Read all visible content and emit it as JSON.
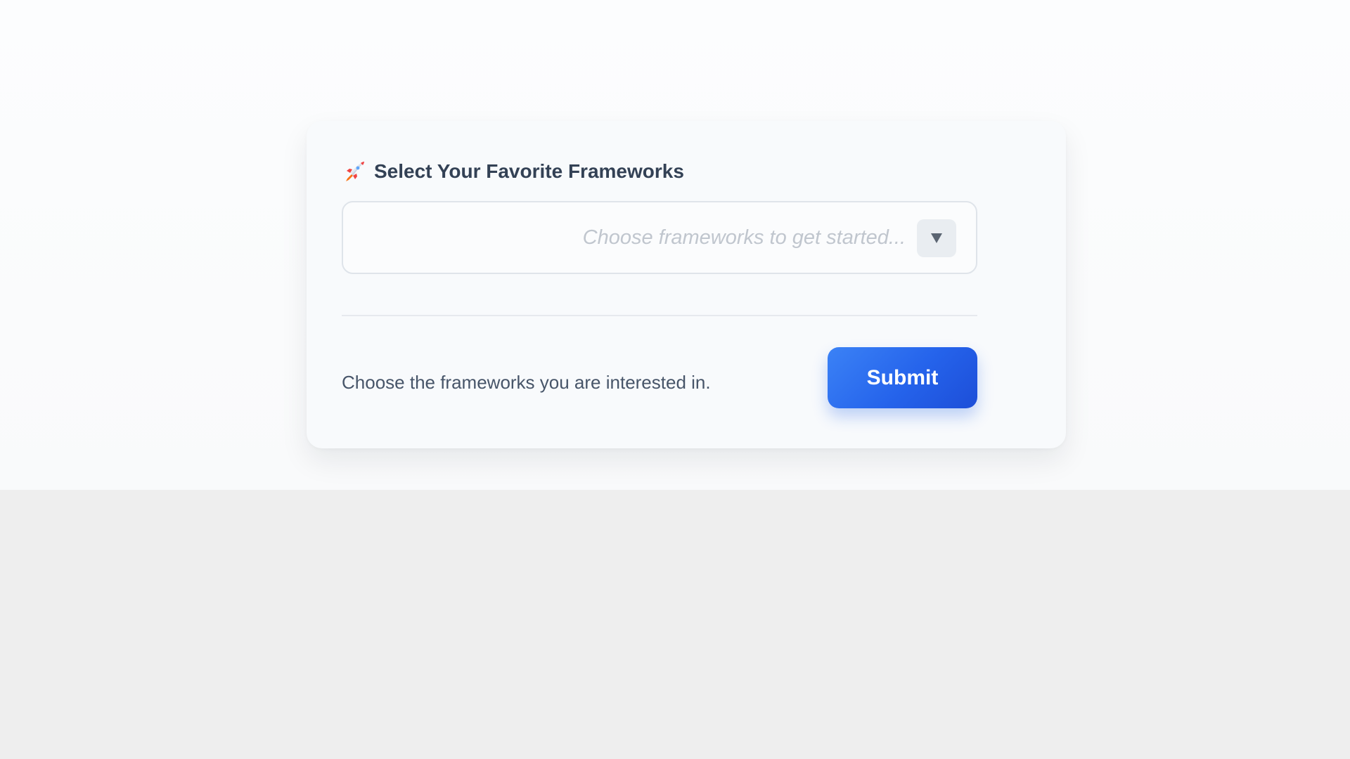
{
  "card": {
    "title": "Select Your Favorite Frameworks",
    "title_icon": "rocket-icon"
  },
  "select": {
    "placeholder": "Choose frameworks to get started...",
    "toggle_icon": "chevron-down-icon"
  },
  "footer": {
    "help_text": "Choose the frameworks you are interested in.",
    "submit_label": "Submit"
  },
  "colors": {
    "accent": "#2563eb",
    "title_text": "#334155",
    "placeholder_text": "#c0c6ce",
    "body_text": "#475569"
  }
}
